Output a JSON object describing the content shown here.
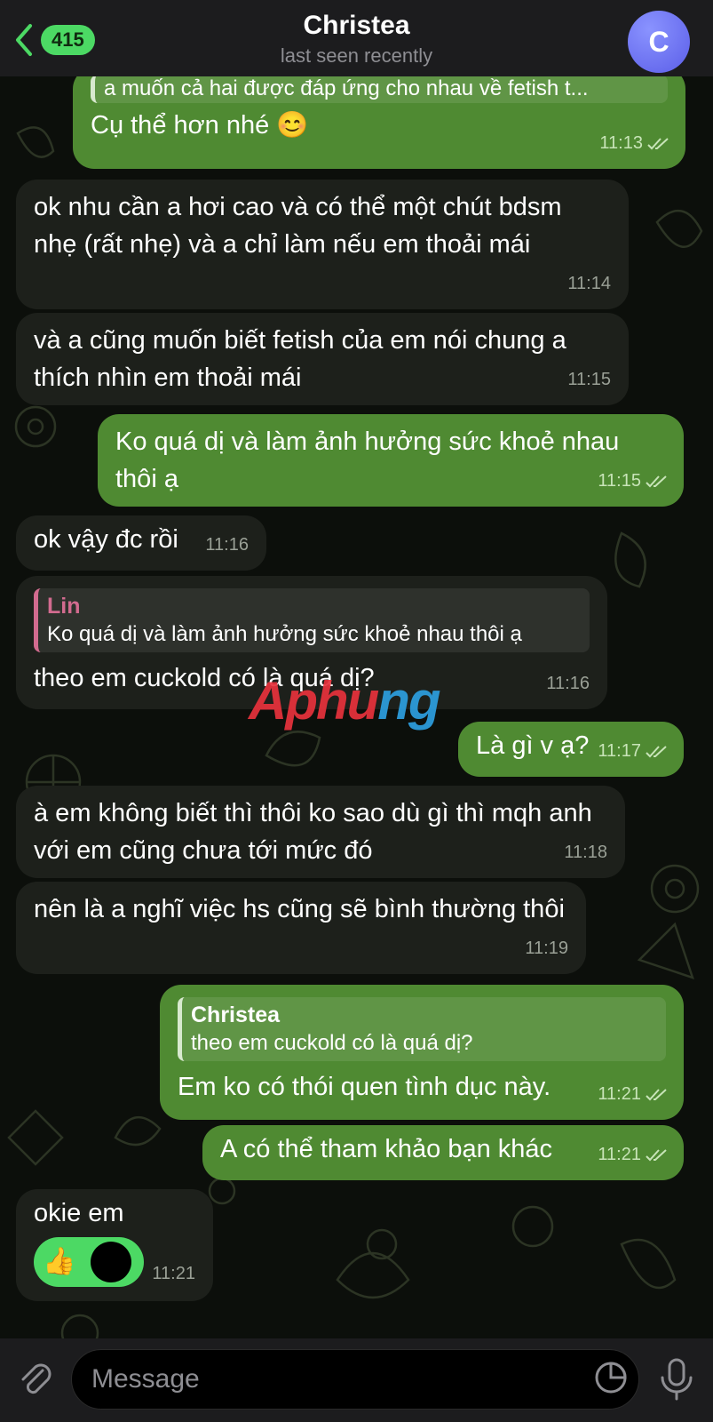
{
  "header": {
    "back_count": "415",
    "title": "Christea",
    "subtitle": "last seen recently",
    "avatar_letter": "C"
  },
  "messages": [
    {
      "quote_text": "a muốn cả hai được đáp ứng cho nhau về fetish t...",
      "text": "Cụ thể hơn nhé 😊",
      "time": "11:13"
    },
    {
      "text": "ok nhu cần a hơi cao và có thể một chút bdsm nhẹ (rất nhẹ) và a chỉ làm nếu em thoải mái",
      "time": "11:14"
    },
    {
      "text": "và a cũng muốn biết fetish của em nói chung a thích nhìn em thoải mái",
      "time": "11:15"
    },
    {
      "text": "Ko quá dị và làm ảnh hưởng sức khoẻ nhau thôi ạ",
      "time": "11:15"
    },
    {
      "text": "ok vậy đc rồi",
      "time": "11:16"
    },
    {
      "reply_name": "Lin",
      "reply_text": "Ko quá dị và làm ảnh hưởng sức khoẻ nhau thôi ạ",
      "text": "theo em cuckold có là quá dị?",
      "time": "11:16"
    },
    {
      "text": "Là gì v ạ?",
      "time": "11:17"
    },
    {
      "text": "à em không biết thì thôi ko sao dù gì thì mqh anh với em cũng chưa tới mức đó",
      "time": "11:18"
    },
    {
      "text": "nên là a nghĩ việc hs cũng sẽ bình thường thôi",
      "time": "11:19"
    },
    {
      "reply_name": "Christea",
      "reply_text": "theo em cuckold có là quá dị?",
      "text": "Em ko có thói quen tình dục này.",
      "time": "11:21"
    },
    {
      "text": "A có thể tham khảo bạn khác",
      "time": "11:21"
    },
    {
      "text": "okie em",
      "time": "11:21",
      "reaction": "👍"
    }
  ],
  "watermark": {
    "part1": "Aphu",
    "part2": "ng"
  },
  "composer": {
    "placeholder": "Message"
  },
  "colors": {
    "incoming": "#1d201b",
    "outgoing": "#4f8a32",
    "accent": "#4cd964",
    "avatar": "#6b6ef0"
  }
}
